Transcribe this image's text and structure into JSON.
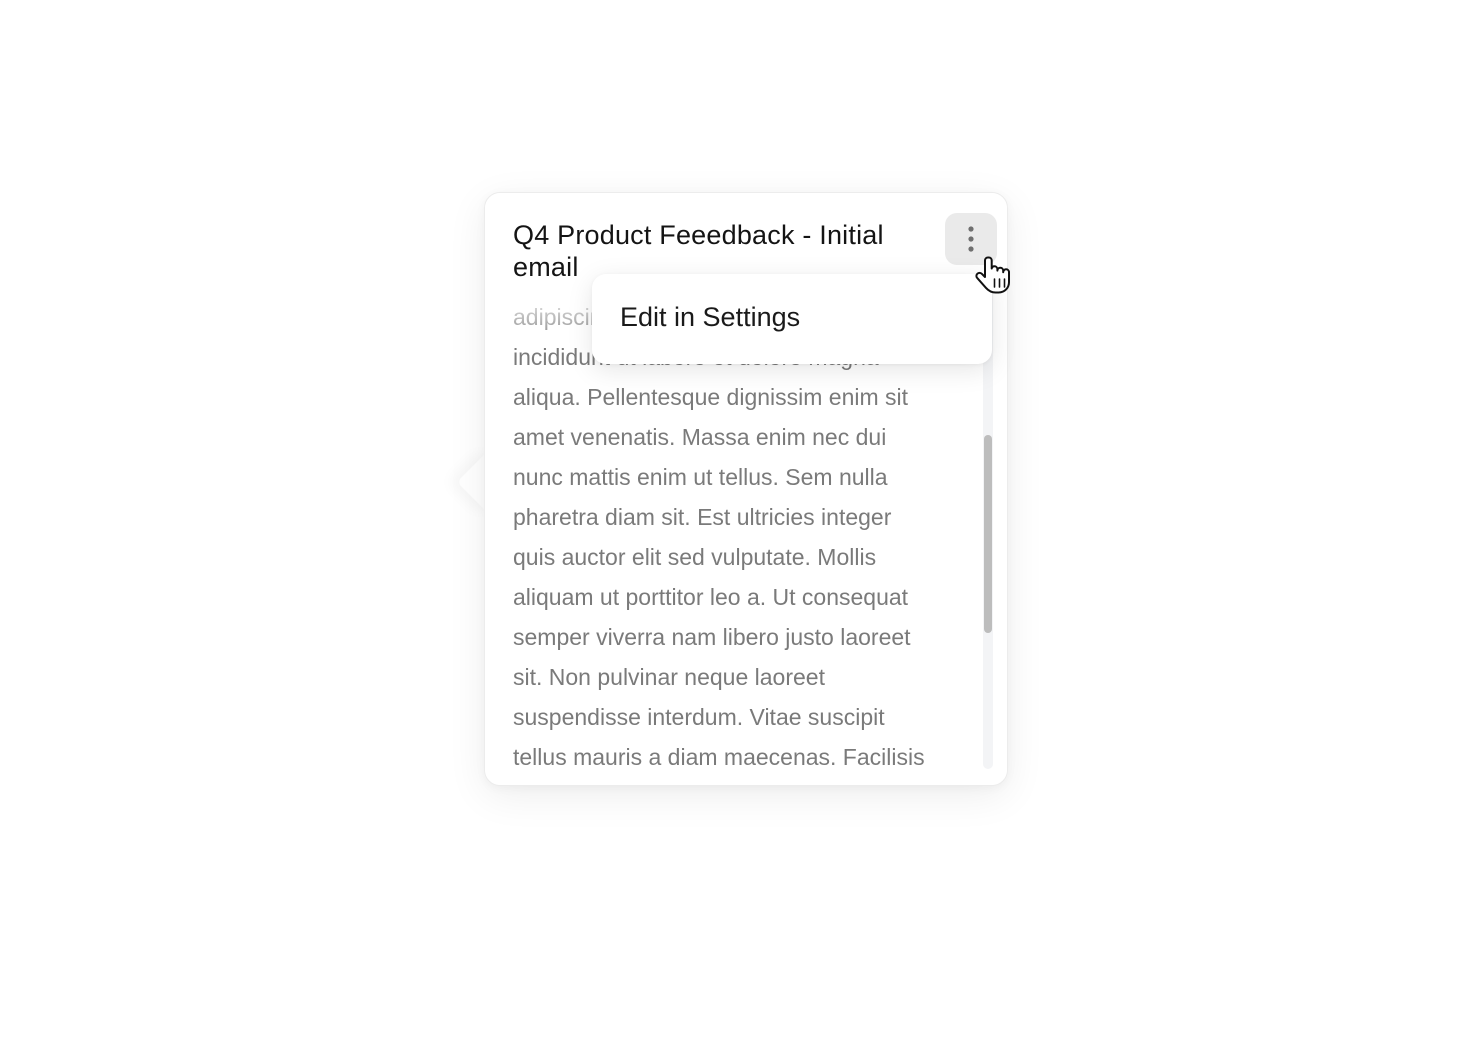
{
  "popover": {
    "title": "Q4 Product Feeedback - Initial email",
    "body_lines": [
      "adipiscing elit, sed do eiusmod tempor",
      "incididunt ut labore et dolore magna",
      "aliqua. Pellentesque dignissim enim sit",
      "amet venenatis. Massa enim nec dui",
      "nunc mattis enim ut tellus. Sem nulla",
      "pharetra diam sit. Est ultricies integer",
      "quis auctor elit sed vulputate. Mollis",
      "aliquam ut porttitor leo a. Ut consequat",
      "semper viverra nam libero justo laoreet",
      "sit. Non pulvinar neque laoreet",
      "suspendisse interdum. Vitae suscipit",
      "tellus mauris a diam maecenas. Facilisis"
    ],
    "more_button_icon": "vertical-ellipsis-icon"
  },
  "dropdown_menu": {
    "items": [
      {
        "label": "Edit in Settings"
      }
    ]
  },
  "cursor": {
    "icon": "hand-pointer-cursor-icon"
  },
  "colors": {
    "title_text": "#141414",
    "body_text": "#7a7a7a",
    "kebab_background": "#eaeaea",
    "scroll_thumb": "#bdbdbd",
    "scroll_track": "#f3f4f6"
  }
}
